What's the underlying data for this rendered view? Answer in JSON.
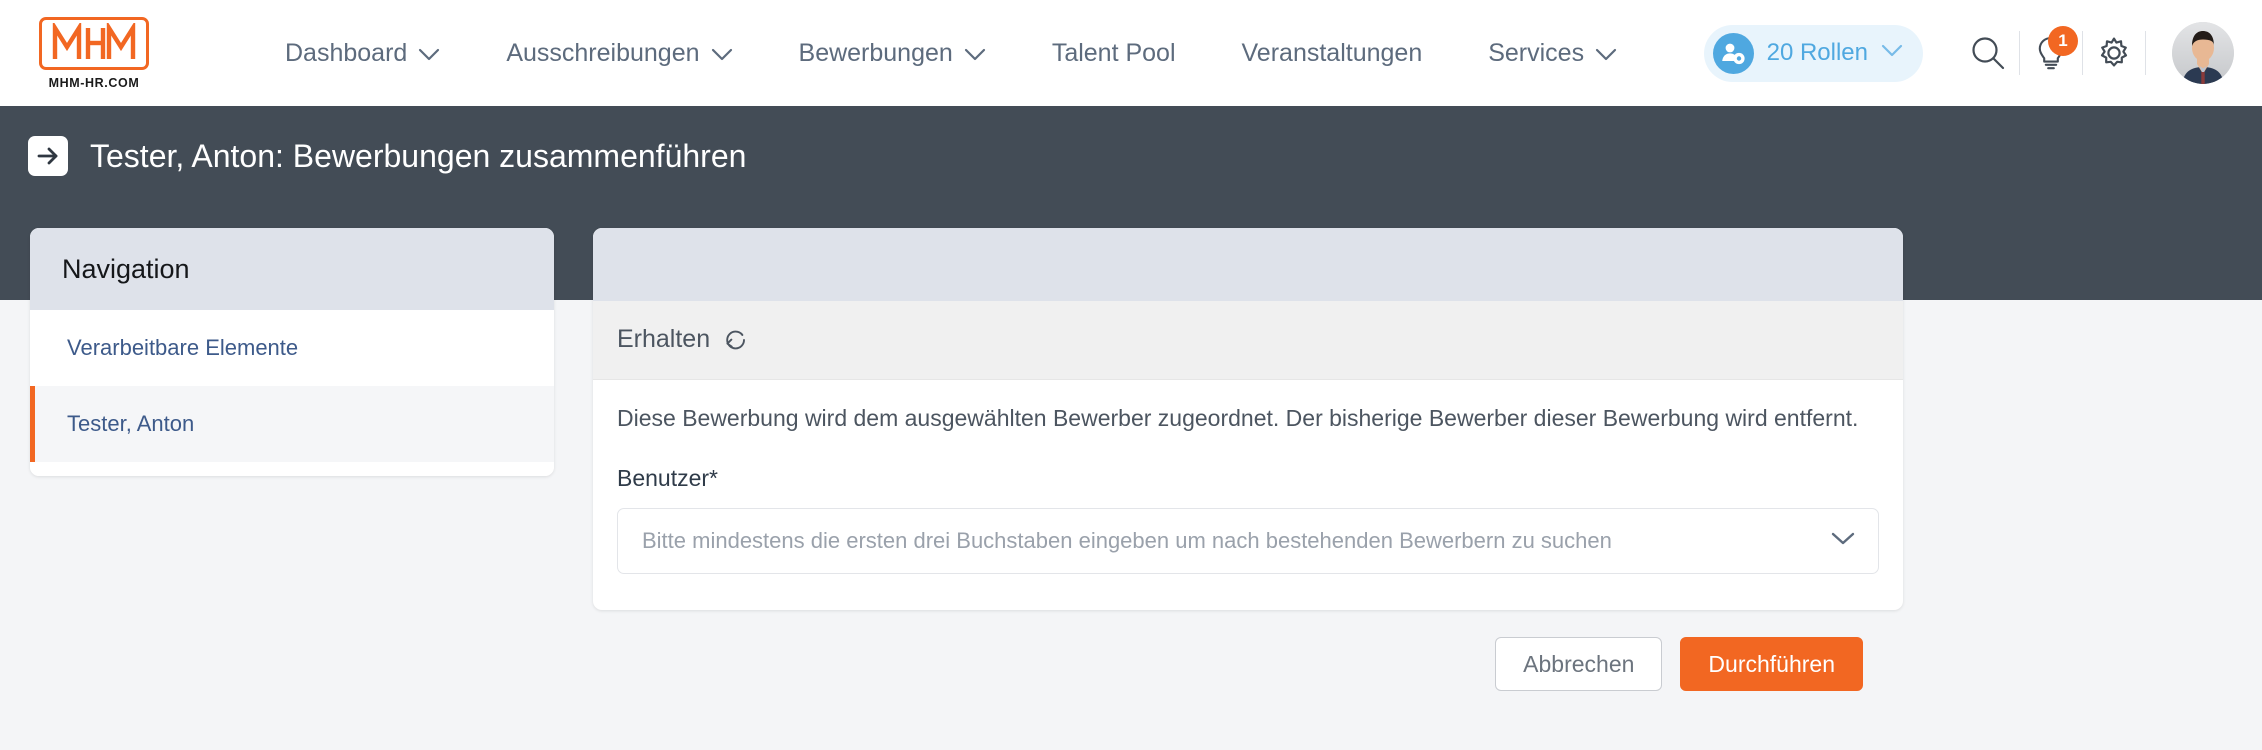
{
  "brand": {
    "logo_text": "MHM",
    "logo_sub": "MHM-HR.COM",
    "accent_color": "#f26722",
    "dark_color": "#434c56",
    "link_color": "#3d5a8a"
  },
  "topnav": {
    "items": [
      {
        "label": "Dashboard",
        "has_caret": true
      },
      {
        "label": "Ausschreibungen",
        "has_caret": true
      },
      {
        "label": "Bewerbungen",
        "has_caret": true
      },
      {
        "label": "Talent Pool",
        "has_caret": false
      },
      {
        "label": "Veranstaltungen",
        "has_caret": false
      },
      {
        "label": "Services",
        "has_caret": true
      }
    ],
    "roles_pill": {
      "label": "20 Rollen",
      "icon": "user-gear-icon",
      "background": "#e8f4fc",
      "text_color": "#4fa8e0"
    },
    "actions": [
      {
        "icon": "search-icon",
        "badge": null
      },
      {
        "icon": "lightbulb-icon",
        "badge": "1"
      },
      {
        "icon": "gear-icon",
        "badge": null
      }
    ],
    "avatar": "user-avatar"
  },
  "page": {
    "back_icon": "arrow-right-icon",
    "title": "Tester, Anton: Bewerbungen zusammenführen"
  },
  "navigation_card": {
    "header": "Navigation",
    "items": [
      {
        "label": "Verarbeitbare Elemente",
        "active": false
      },
      {
        "label": "Tester, Anton",
        "active": true
      }
    ]
  },
  "panel": {
    "section_title": "Erhalten",
    "section_icon": "refresh-icon",
    "description": "Diese Bewerbung wird dem ausgewählten Bewerber zugeordnet. Der bisherige Bewerber dieser Bewerbung wird entfernt.",
    "field": {
      "label": "Benutzer*",
      "value": "",
      "placeholder": "Bitte mindestens die ersten drei Buchstaben eingeben um nach bestehenden Bewerbern zu suchen",
      "dropdown_icon": "chevron-down-icon"
    }
  },
  "footer": {
    "cancel_label": "Abbrechen",
    "submit_label": "Durchführen"
  }
}
